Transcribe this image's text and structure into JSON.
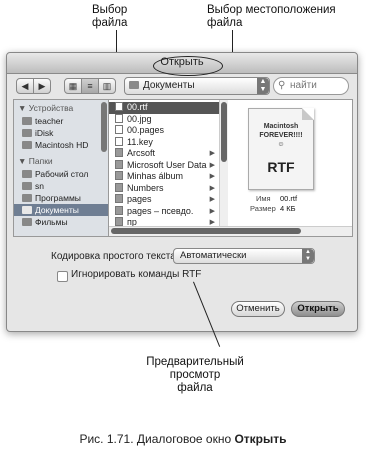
{
  "callouts": {
    "file_select": "Выбор\nфайла",
    "location_select": "Выбор местоположения\nфайла",
    "preview": "Предварительный\nпросмотр\nфайла"
  },
  "dialog": {
    "title": "Открыть",
    "toolbar": {
      "back": "◀",
      "forward": "▶",
      "location": "Документы",
      "search_placeholder": "найти"
    },
    "sidebar": {
      "devices_header": "▼ Устройства",
      "devices": [
        "teacher",
        "iDisk",
        "Macintosh HD"
      ],
      "places_header": "▼ Папки",
      "places": [
        "Рабочий стол",
        "sn",
        "Программы",
        "Документы",
        "Фильмы"
      ],
      "selected": "Документы"
    },
    "files": [
      {
        "name": "00.rtf",
        "folder": false,
        "selected": true
      },
      {
        "name": "00.jpg",
        "folder": false
      },
      {
        "name": "00.pages",
        "folder": false
      },
      {
        "name": "11.key",
        "folder": false
      },
      {
        "name": "Arcsoft",
        "folder": true
      },
      {
        "name": "Microsoft User Data",
        "folder": true
      },
      {
        "name": "Minhas álbum",
        "folder": true
      },
      {
        "name": "Numbers",
        "folder": true
      },
      {
        "name": "pages",
        "folder": true
      },
      {
        "name": "pages – псевдо.",
        "folder": true
      },
      {
        "name": "пр",
        "folder": true
      }
    ],
    "preview": {
      "doc_line1": "Macintosh",
      "doc_line2": "FOREVER!!!!",
      "doc_smile": "☺",
      "doc_type": "RTF",
      "name_label": "Имя",
      "name_value": "00.rtf",
      "size_label": "Размер",
      "size_value": "4 КБ"
    },
    "options": {
      "encoding_label": "Кодировка простого текста:",
      "encoding_value": "Автоматически",
      "ignore_rtf_label": "Игнорировать команды RTF",
      "ignore_rtf_checked": false
    },
    "buttons": {
      "cancel": "Отменить",
      "open": "Открыть"
    }
  },
  "caption": {
    "prefix": "Рис. 1.71.",
    "middle": " Диалоговое окно ",
    "bold": "Открыть"
  }
}
